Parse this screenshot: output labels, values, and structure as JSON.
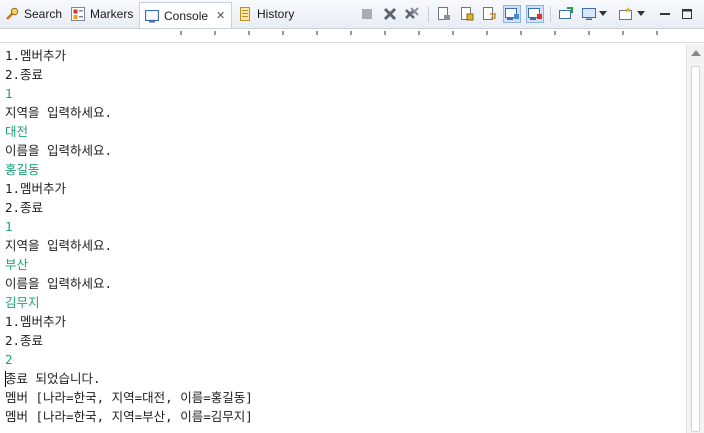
{
  "tabs": [
    {
      "label": "Search",
      "icon": "search-icon"
    },
    {
      "label": "Markers",
      "icon": "markers-icon"
    },
    {
      "label": "Console",
      "icon": "console-icon",
      "active": true
    },
    {
      "label": "History",
      "icon": "history-icon"
    }
  ],
  "toolbar": {
    "icons": [
      "stop-icon",
      "remove-launch-icon",
      "remove-all-terminated-icon",
      "clear-console-icon",
      "scroll-lock-icon",
      "word-wrap-icon",
      "show-on-stdout-icon",
      "show-on-stderr-icon",
      "pin-console-icon",
      "display-console-icon",
      "open-console-icon",
      "minimize-icon",
      "maximize-icon"
    ]
  },
  "colors": {
    "input_text": "#1aa37a",
    "output_text": "#1e1e1e"
  },
  "console_lines": [
    {
      "text": "1.멤버추가",
      "type": "output"
    },
    {
      "text": "2.종료",
      "type": "output"
    },
    {
      "text": "1",
      "type": "input"
    },
    {
      "text": "지역을 입력하세요.",
      "type": "output"
    },
    {
      "text": "대전",
      "type": "input"
    },
    {
      "text": "이름을 입력하세요.",
      "type": "output"
    },
    {
      "text": "홍길동",
      "type": "input"
    },
    {
      "text": "1.멤버추가",
      "type": "output"
    },
    {
      "text": "2.종료",
      "type": "output"
    },
    {
      "text": "1",
      "type": "input"
    },
    {
      "text": "지역을 입력하세요.",
      "type": "output"
    },
    {
      "text": "부산",
      "type": "input"
    },
    {
      "text": "이름을 입력하세요.",
      "type": "output"
    },
    {
      "text": "김무지",
      "type": "input"
    },
    {
      "text": "1.멤버추가",
      "type": "output"
    },
    {
      "text": "2.종료",
      "type": "output"
    },
    {
      "text": "2",
      "type": "input"
    },
    {
      "text": "종료 되었습니다.",
      "type": "output"
    },
    {
      "text": "멤버 [나라=한국, 지역=대전, 이름=홍길동]",
      "type": "output"
    },
    {
      "text": "멤버 [나라=한국, 지역=부산, 이름=김무지]",
      "type": "output"
    }
  ]
}
